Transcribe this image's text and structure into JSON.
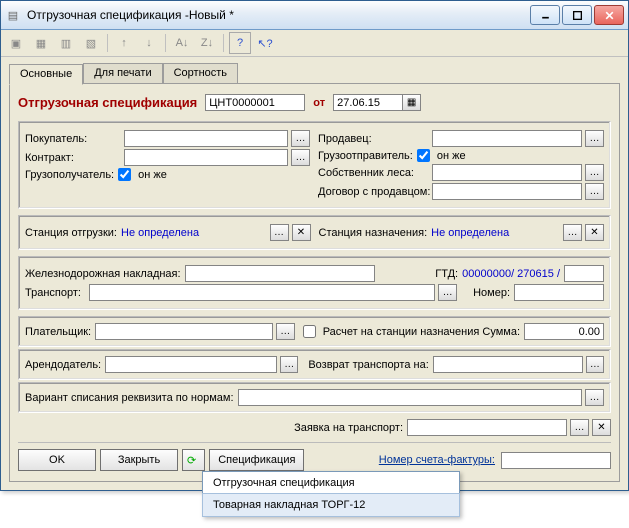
{
  "window": {
    "title": "Отгрузочная спецификация                -Новый *"
  },
  "tabs": {
    "t1": "Основные",
    "t2": "Для печати",
    "t3": "Сортность"
  },
  "header": {
    "title": "Отгрузочная спецификация",
    "docnum": "ЦНТ0000001",
    "ot": "от",
    "date": "27.06.15"
  },
  "left": {
    "buyer_lbl": "Покупатель:",
    "contract_lbl": "Контракт:",
    "consignee_lbl": "Грузополучатель:",
    "same": "он же"
  },
  "right": {
    "seller_lbl": "Продавец:",
    "shipper_lbl": "Грузоотправитель:",
    "same": "он же",
    "forest_owner_lbl": "Собственник леса:",
    "seller_contract_lbl": "Договор c продавцом:"
  },
  "stations": {
    "dep_lbl": "Станция отгрузки:",
    "dest_lbl": "Станция назначения:",
    "undef": "Не определена"
  },
  "rail": {
    "waybill_lbl": "Железнодорожная накладная:",
    "gtd_lbl": "ГТД:",
    "gtd_val": "00000000/  270615  /",
    "transport_lbl": "Транспорт:",
    "number_lbl": "Номер:"
  },
  "payer": {
    "lbl": "Плательщик:",
    "calc_lbl": "Расчет на станции назначения  Сумма:",
    "sum": "0.00"
  },
  "lessor": {
    "lbl": "Арендодатель:",
    "return_lbl": "Возврат транспорта на:"
  },
  "writeoff": {
    "lbl": "Вариант списания реквизита по нормам:"
  },
  "request": {
    "lbl": "Заявка на транспорт:"
  },
  "invoice": {
    "lbl": "Номер счета-фактуры:"
  },
  "buttons": {
    "ok": "OK",
    "close": "Закрыть",
    "spec": "Спецификация"
  },
  "menu": {
    "i1": "Отгрузочная спецификация",
    "i2": "Товарная накладная ТОРГ-12"
  }
}
